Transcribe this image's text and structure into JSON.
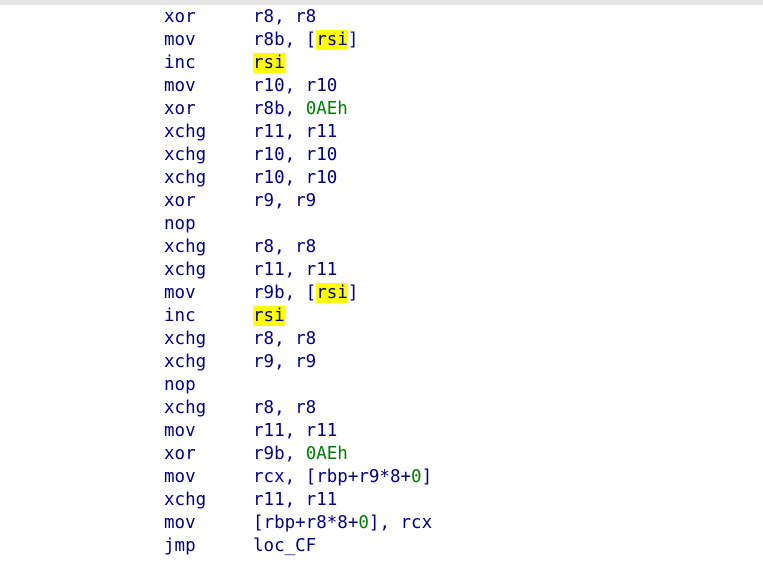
{
  "colors": {
    "text": "#000080",
    "number": "#008000",
    "highlight": "#ffff00",
    "background": "#ffffff"
  },
  "disassembly": {
    "lines": [
      {
        "mnemonic": "xor",
        "operands": [
          {
            "t": "r8, r8"
          }
        ]
      },
      {
        "mnemonic": "mov",
        "operands": [
          {
            "t": "r8b, ["
          },
          {
            "t": "rsi",
            "hl": true
          },
          {
            "t": "]"
          }
        ]
      },
      {
        "mnemonic": "inc",
        "operands": [
          {
            "t": "rsi",
            "hl": true
          }
        ]
      },
      {
        "mnemonic": "mov",
        "operands": [
          {
            "t": "r10, r10"
          }
        ]
      },
      {
        "mnemonic": "xor",
        "operands": [
          {
            "t": "r8b, "
          },
          {
            "t": "0AEh",
            "num": true
          }
        ]
      },
      {
        "mnemonic": "xchg",
        "operands": [
          {
            "t": "r11, r11"
          }
        ]
      },
      {
        "mnemonic": "xchg",
        "operands": [
          {
            "t": "r10, r10"
          }
        ]
      },
      {
        "mnemonic": "xchg",
        "operands": [
          {
            "t": "r10, r10"
          }
        ]
      },
      {
        "mnemonic": "xor",
        "operands": [
          {
            "t": "r9, r9"
          }
        ]
      },
      {
        "mnemonic": "nop",
        "operands": []
      },
      {
        "mnemonic": "xchg",
        "operands": [
          {
            "t": "r8, r8"
          }
        ]
      },
      {
        "mnemonic": "xchg",
        "operands": [
          {
            "t": "r11, r11"
          }
        ]
      },
      {
        "mnemonic": "mov",
        "operands": [
          {
            "t": "r9b, ["
          },
          {
            "t": "rsi",
            "hl": true
          },
          {
            "t": "]"
          }
        ]
      },
      {
        "mnemonic": "inc",
        "operands": [
          {
            "t": "rsi",
            "hl": true
          }
        ]
      },
      {
        "mnemonic": "xchg",
        "operands": [
          {
            "t": "r8, r8"
          }
        ]
      },
      {
        "mnemonic": "xchg",
        "operands": [
          {
            "t": "r9, r9"
          }
        ]
      },
      {
        "mnemonic": "nop",
        "operands": []
      },
      {
        "mnemonic": "xchg",
        "operands": [
          {
            "t": "r8, r8"
          }
        ]
      },
      {
        "mnemonic": "mov",
        "operands": [
          {
            "t": "r11, r11"
          }
        ]
      },
      {
        "mnemonic": "xor",
        "operands": [
          {
            "t": "r9b, "
          },
          {
            "t": "0AEh",
            "num": true
          }
        ]
      },
      {
        "mnemonic": "mov",
        "operands": [
          {
            "t": "rcx, [rbp+r9*8+"
          },
          {
            "t": "0",
            "num": true
          },
          {
            "t": "]"
          }
        ]
      },
      {
        "mnemonic": "xchg",
        "operands": [
          {
            "t": "r11, r11"
          }
        ]
      },
      {
        "mnemonic": "mov",
        "operands": [
          {
            "t": "[rbp+r8*8+"
          },
          {
            "t": "0",
            "num": true
          },
          {
            "t": "], rcx"
          }
        ]
      },
      {
        "mnemonic": "jmp",
        "operands": [
          {
            "t": "loc_CF"
          }
        ]
      }
    ]
  }
}
